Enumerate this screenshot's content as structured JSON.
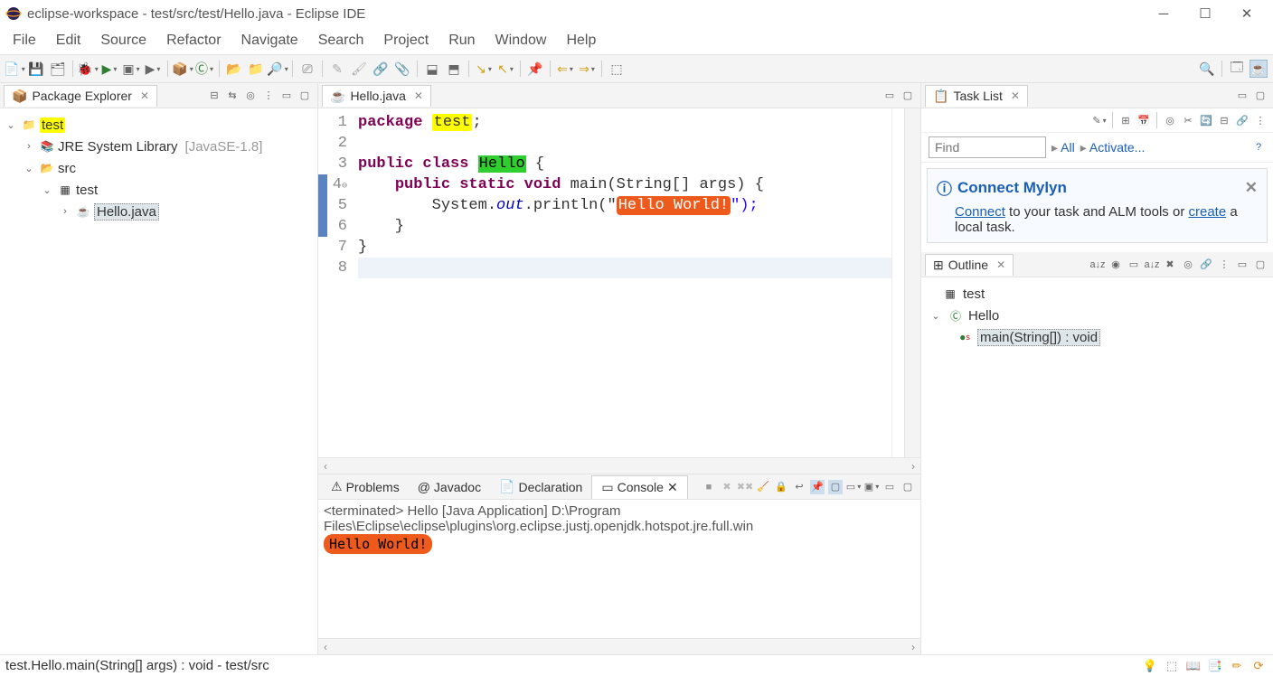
{
  "window": {
    "title": "eclipse-workspace - test/src/test/Hello.java - Eclipse IDE"
  },
  "menu": [
    "File",
    "Edit",
    "Source",
    "Refactor",
    "Navigate",
    "Search",
    "Project",
    "Run",
    "Window",
    "Help"
  ],
  "package_explorer": {
    "title": "Package Explorer",
    "project": "test",
    "jre_label": "JRE System Library",
    "jre_version": "[JavaSE-1.8]",
    "src": "src",
    "pkg": "test",
    "file": "Hello.java"
  },
  "editor": {
    "tab": "Hello.java",
    "lines": [
      "1",
      "2",
      "3",
      "4",
      "5",
      "6",
      "7",
      "8"
    ],
    "code": {
      "l1_pkg_kw": "package",
      "l1_pkg_name": "test",
      "l3_public": "public",
      "l3_class": "class",
      "l3_name": "Hello",
      "l3_brace": " {",
      "l4": "public static void",
      "l4_rest": " main(String[] args) {",
      "l5_pre": "System.",
      "l5_out": "out",
      "l5_mid": ".println(\"",
      "l5_str": "Hello World!",
      "l5_post": "\");",
      "l6": "    }",
      "l7": "}"
    }
  },
  "tasklist": {
    "title": "Task List",
    "find_placeholder": "Find",
    "crumb_all": "All",
    "crumb_activate": "Activate..."
  },
  "mylyn": {
    "header": "Connect Mylyn",
    "link1": "Connect",
    "text1": " to your task and ALM tools or ",
    "link2": "create",
    "text2": " a local task."
  },
  "outline": {
    "title": "Outline",
    "pkg": "test",
    "cls": "Hello",
    "method": "main(String[]) : void"
  },
  "bottom": {
    "tabs": {
      "problems": "Problems",
      "javadoc": "Javadoc",
      "declaration": "Declaration",
      "console": "Console"
    },
    "console_header": "<terminated> Hello [Java Application] D:\\Program Files\\Eclipse\\eclipse\\plugins\\org.eclipse.justj.openjdk.hotspot.jre.full.win",
    "console_output": "Hello World!"
  },
  "status": {
    "left": "test.Hello.main(String[] args) : void - test/src"
  }
}
